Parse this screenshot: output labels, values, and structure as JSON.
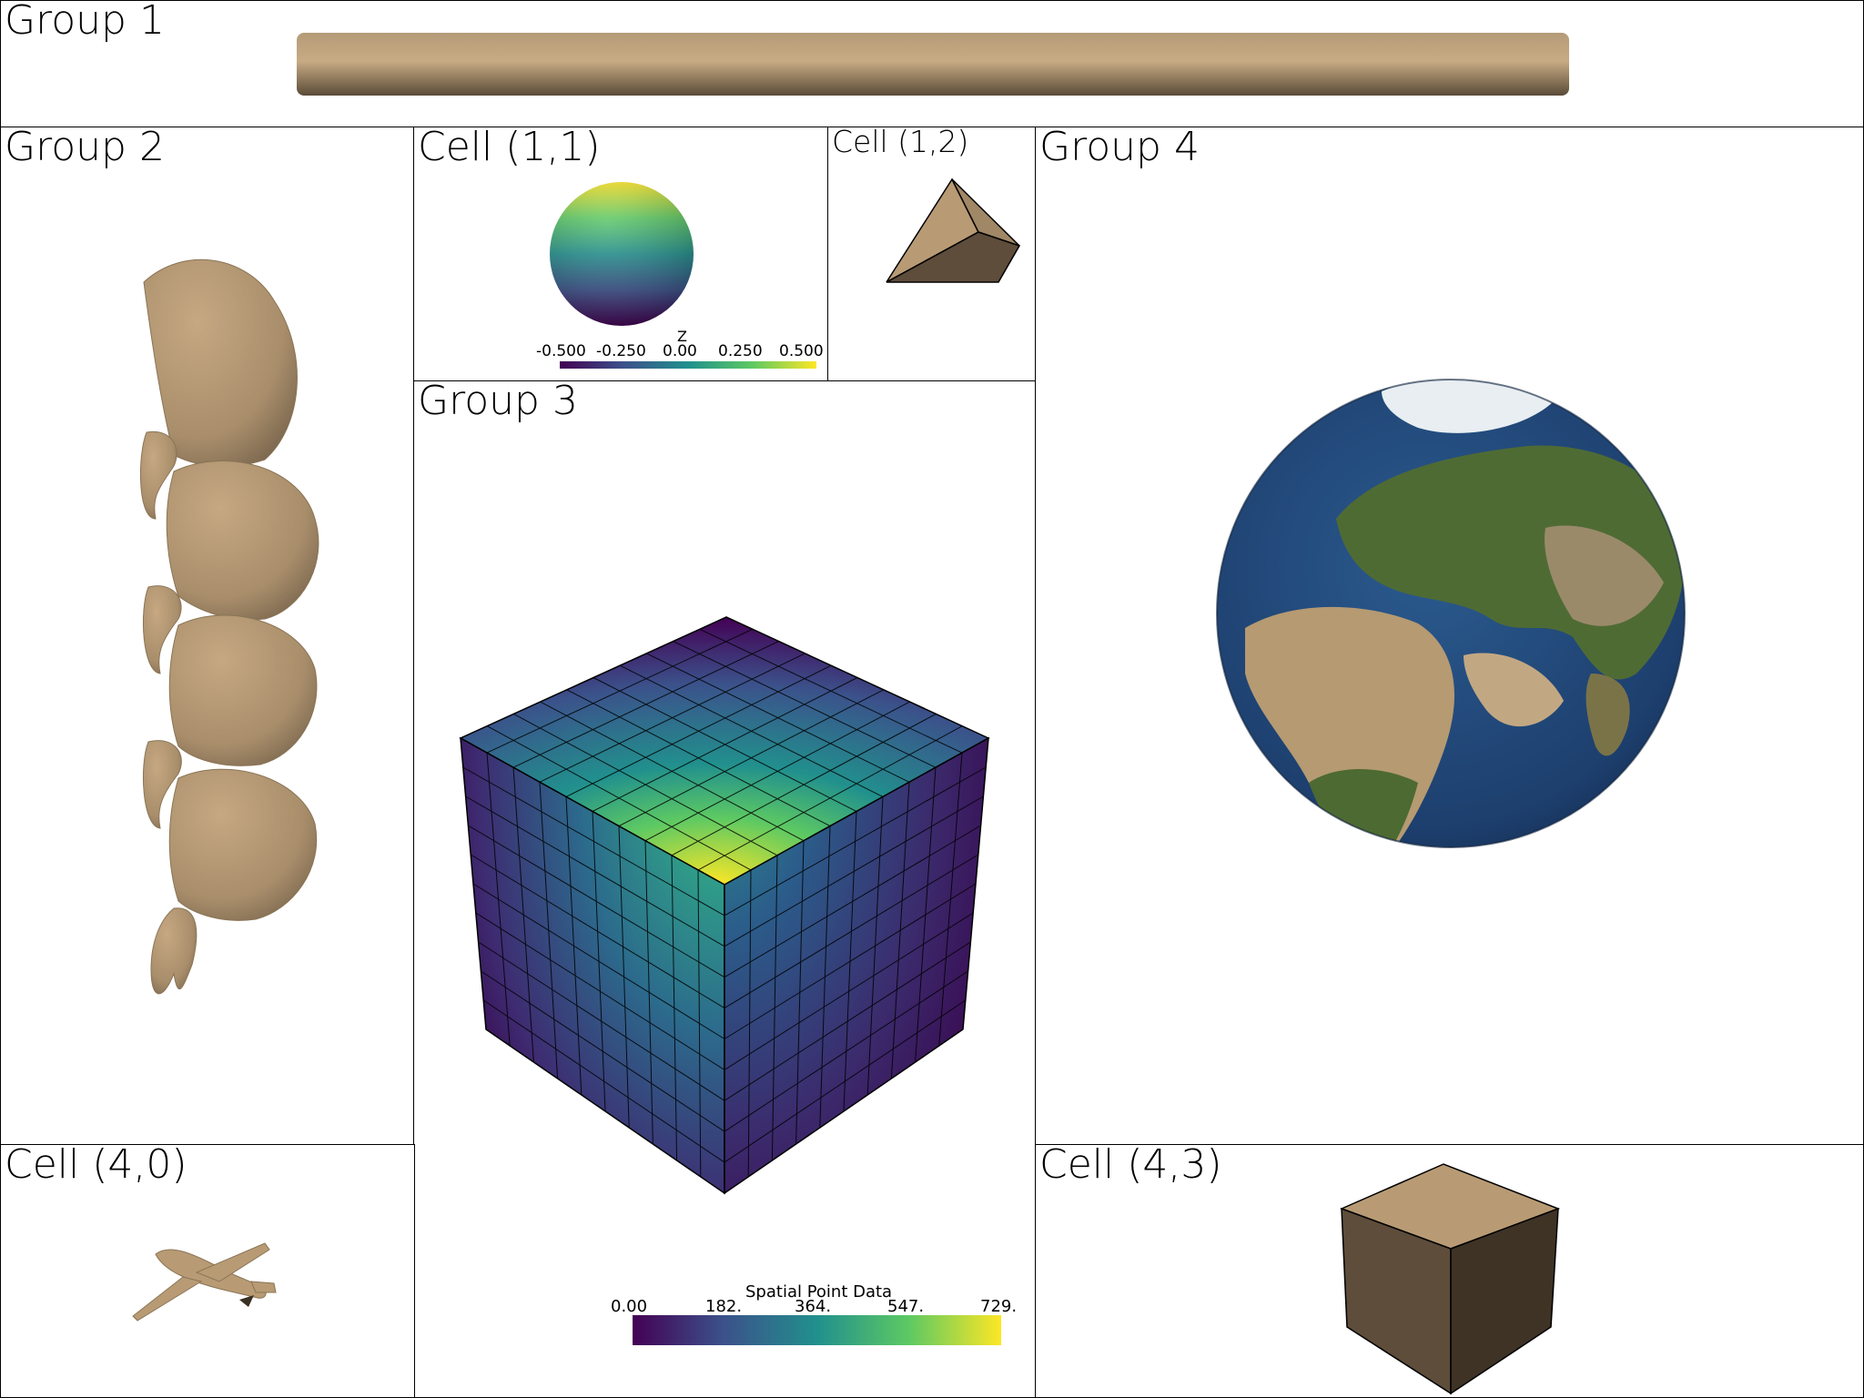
{
  "panels": {
    "group1": "Group 1",
    "group2": "Group 2",
    "cell_1_1": "Cell (1,1)",
    "cell_1_2": "Cell (1,2)",
    "group3": "Group 3",
    "group4": "Group 4",
    "cell_4_0": "Cell (4,0)",
    "cell_4_3": "Cell (4,3)"
  },
  "sphere_colorbar": {
    "title": "Z",
    "ticks": [
      "-0.500",
      "-0.250",
      "0.00",
      "0.250",
      "0.500"
    ]
  },
  "cube_colorbar": {
    "title": "Spatial Point Data",
    "ticks": [
      "0.00",
      "182.",
      "364.",
      "547.",
      "729."
    ]
  },
  "colors": {
    "mesh_tan": "#b89b74",
    "viridis": [
      "#440154",
      "#3b528b",
      "#21908d",
      "#5dc963",
      "#fde725"
    ],
    "ocean": "#1d3f6e"
  },
  "icons": {
    "group1": "cylinder",
    "group2": "spiral-shell",
    "cell_1_1": "sphere",
    "cell_1_2": "tetrahedron",
    "group3": "grid-cube",
    "group4": "globe",
    "cell_4_0": "airplane",
    "cell_4_3": "cube"
  }
}
